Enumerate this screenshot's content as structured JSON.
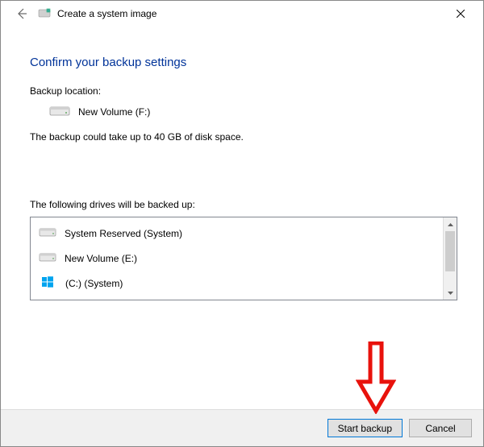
{
  "titlebar": {
    "title": "Create a system image"
  },
  "content": {
    "heading": "Confirm your backup settings",
    "backup_location_label": "Backup location:",
    "backup_location_value": "New Volume (F:)",
    "size_info": "The backup could take up to 40 GB of disk space.",
    "drives_label": "The following drives will be backed up:",
    "drives": [
      {
        "name": "System Reserved (System)",
        "icon": "drive"
      },
      {
        "name": "New Volume (E:)",
        "icon": "drive"
      },
      {
        "name": "(C:) (System)",
        "icon": "windows"
      }
    ]
  },
  "buttons": {
    "start": "Start backup",
    "cancel": "Cancel"
  }
}
